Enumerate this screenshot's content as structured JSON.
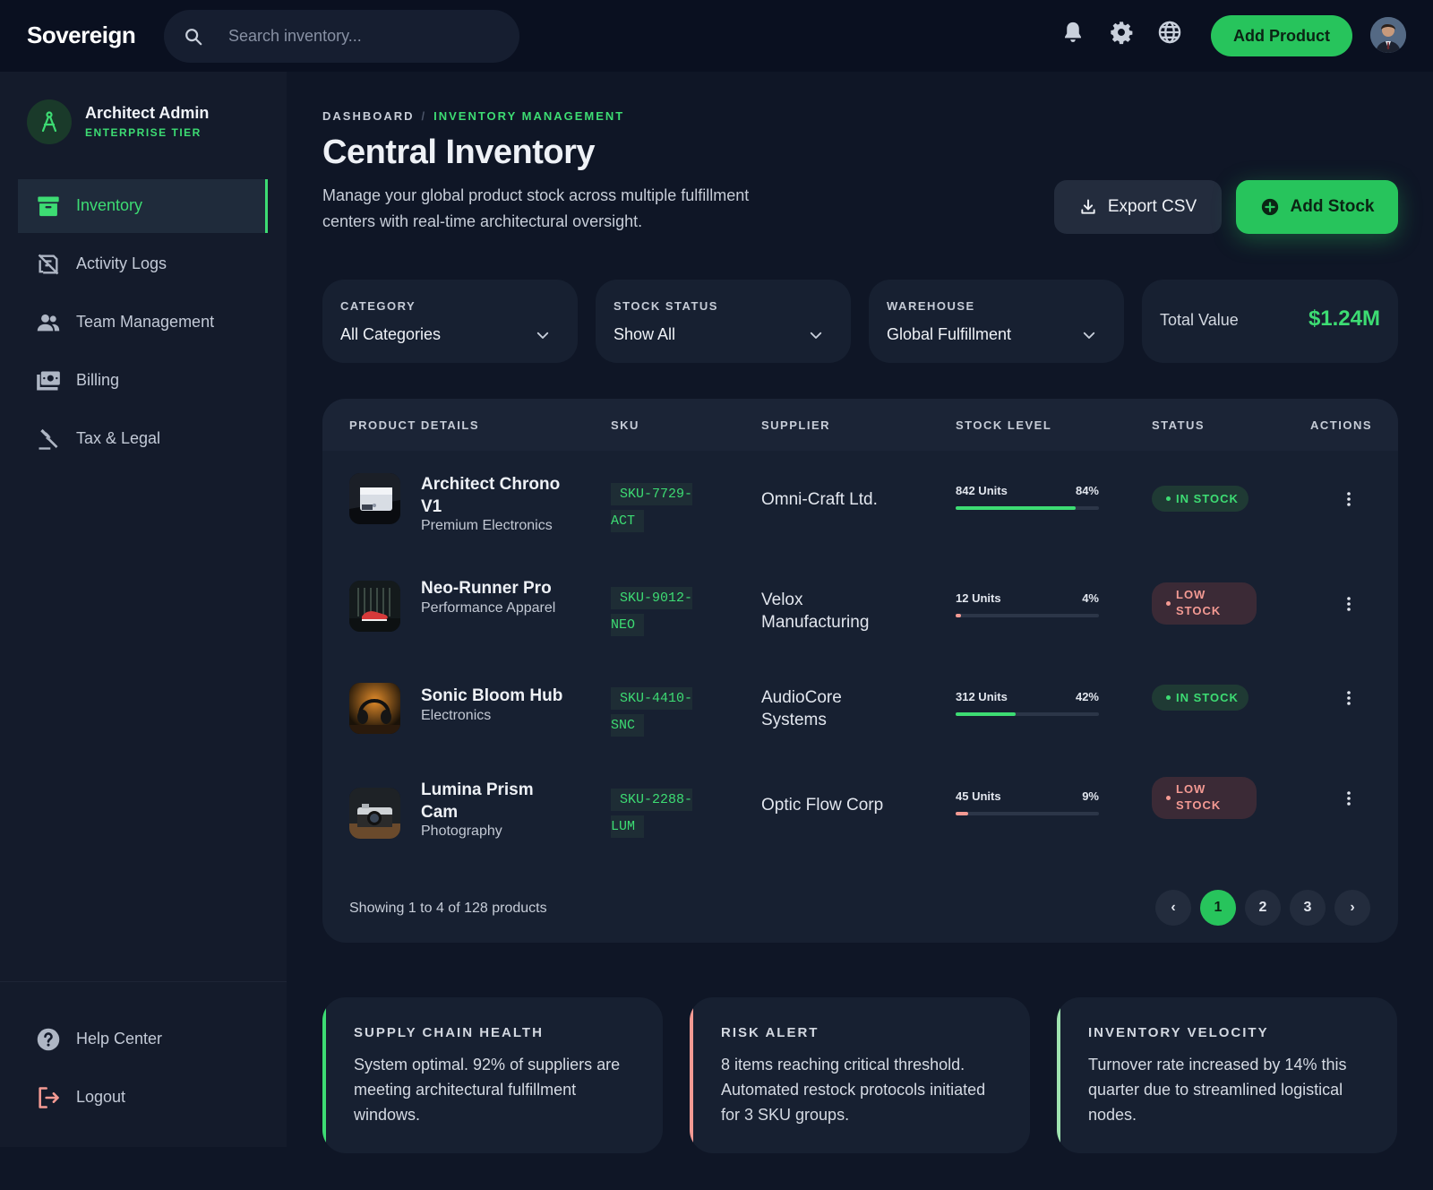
{
  "brand": "Sovereign",
  "search": {
    "placeholder": "Search inventory..."
  },
  "topbar": {
    "add_product_label": "Add Product"
  },
  "icons": {
    "search": "search-icon",
    "notifications": "bell-icon",
    "settings": "gear-icon",
    "language": "globe-icon"
  },
  "colors": {
    "accent": "#27c45c",
    "accent_text": "#3ddc73",
    "danger": "#f49a93",
    "background": "#0f1626"
  },
  "profile": {
    "name": "Architect Admin",
    "tier": "ENTERPRISE TIER"
  },
  "sidebar": {
    "items": [
      {
        "label": "Inventory",
        "icon": "archive-box-icon",
        "active": true
      },
      {
        "label": "Activity Logs",
        "icon": "activity-log-icon",
        "active": false
      },
      {
        "label": "Team Management",
        "icon": "team-icon",
        "active": false
      },
      {
        "label": "Billing",
        "icon": "billing-icon",
        "active": false
      },
      {
        "label": "Tax & Legal",
        "icon": "gavel-icon",
        "active": false
      }
    ],
    "footer": [
      {
        "label": "Help Center",
        "icon": "help-icon"
      },
      {
        "label": "Logout",
        "icon": "logout-icon"
      }
    ]
  },
  "breadcrumb": {
    "root": "DASHBOARD",
    "separator": "/",
    "current": "INVENTORY MANAGEMENT"
  },
  "page": {
    "title": "Central Inventory",
    "description": "Manage your global product stock across multiple fulfillment centers with real-time architectural oversight.",
    "export_label": "Export CSV",
    "add_stock_label": "Add Stock"
  },
  "filters": [
    {
      "label": "CATEGORY",
      "value": "All Categories"
    },
    {
      "label": "STOCK STATUS",
      "value": "Show All"
    },
    {
      "label": "WAREHOUSE",
      "value": "Global Fulfillment"
    }
  ],
  "total": {
    "label": "Total Value",
    "value": "$1.24M"
  },
  "table": {
    "headers": [
      "PRODUCT DETAILS",
      "SKU",
      "SUPPLIER",
      "STOCK LEVEL",
      "STATUS",
      "ACTIONS"
    ],
    "rows": [
      {
        "name": "Architect Chrono V1",
        "category": "Premium Electronics",
        "sku": "SKU-7729-ACT",
        "supplier": "Omni-Craft Ltd.",
        "units": "842 Units",
        "pct_label": "84%",
        "pct": 84,
        "status": "IN STOCK",
        "status_type": "instock"
      },
      {
        "name": "Neo-Runner Pro",
        "category": "Performance Apparel",
        "sku": "SKU-9012-NEO",
        "supplier": "Velox Manufacturing",
        "units": "12 Units",
        "pct_label": "4%",
        "pct": 4,
        "status": "LOW STOCK",
        "status_type": "low"
      },
      {
        "name": "Sonic Bloom Hub",
        "category": "Electronics",
        "sku": "SKU-4410-SNC",
        "supplier": "AudioCore Systems",
        "units": "312 Units",
        "pct_label": "42%",
        "pct": 42,
        "status": "IN STOCK",
        "status_type": "instock"
      },
      {
        "name": "Lumina Prism Cam",
        "category": "Photography",
        "sku": "SKU-2288-LUM",
        "supplier": "Optic Flow Corp",
        "units": "45 Units",
        "pct_label": "9%",
        "pct": 9,
        "status": "LOW STOCK",
        "status_type": "low"
      }
    ],
    "showing": "Showing 1 to 4 of 128 products",
    "pagination": {
      "prev": "‹",
      "pages": [
        "1",
        "2",
        "3"
      ],
      "current": "1",
      "next": "›"
    }
  },
  "cards": [
    {
      "title": "SUPPLY CHAIN HEALTH",
      "text": "System optimal. 92% of suppliers are meeting architectural fulfillment windows.",
      "accent": "#3ddc73"
    },
    {
      "title": "RISK ALERT",
      "text": "8 items reaching critical threshold. Automated restock protocols initiated for 3 SKU groups.",
      "accent": "#f49a93"
    },
    {
      "title": "INVENTORY VELOCITY",
      "text": "Turnover rate increased by 14% this quarter due to streamlined logistical nodes.",
      "accent": "#9fe3b0"
    }
  ]
}
